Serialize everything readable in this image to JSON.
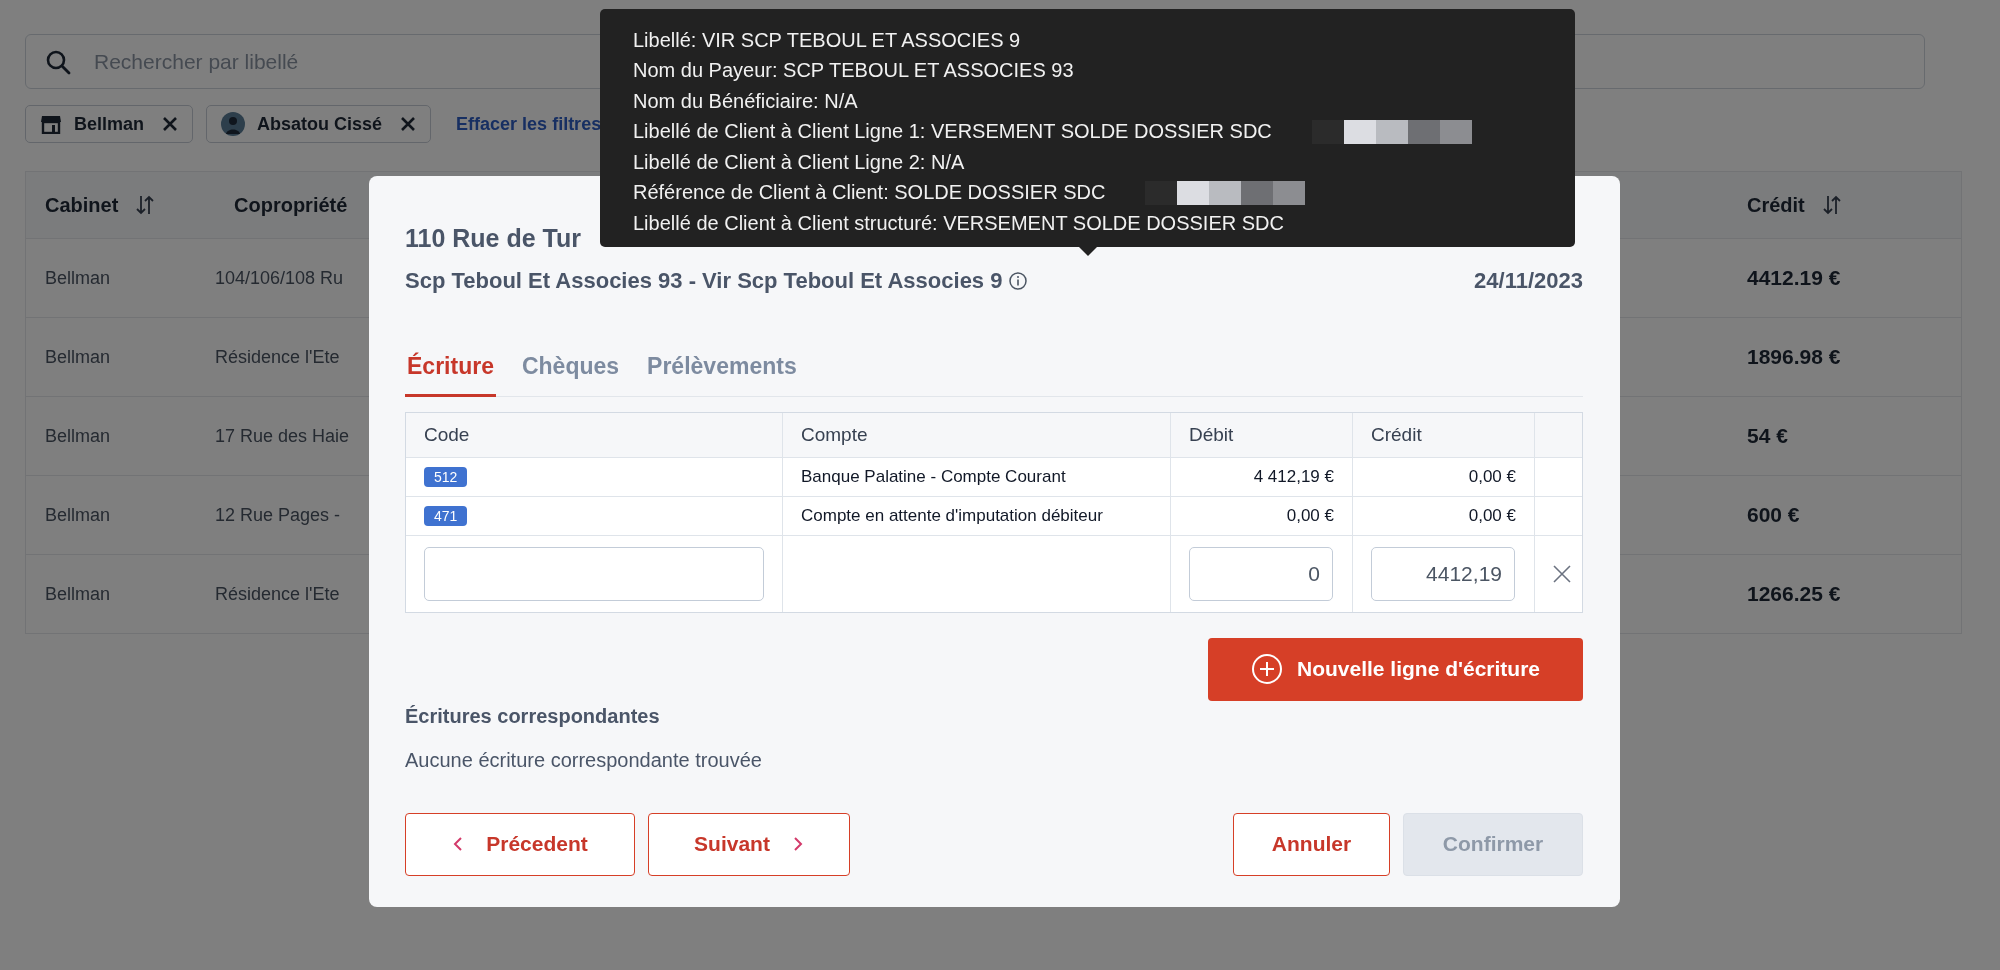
{
  "search": {
    "placeholder": "Rechercher par libellé"
  },
  "filters": [
    {
      "label": "Bellman",
      "kind": "cabinet"
    },
    {
      "label": "Absatou Cissé",
      "kind": "person"
    }
  ],
  "clear_filters": "Effacer les filtres",
  "table": {
    "columns": [
      {
        "label": "Cabinet",
        "sortable": true
      },
      {
        "label": "Copropriété",
        "sortable": false
      },
      {
        "label": "Crédit",
        "sortable": true
      }
    ],
    "rows": [
      {
        "cabinet": "Bellman",
        "copropriete": "104/106/108 Ru",
        "credit": "4412.19 €"
      },
      {
        "cabinet": "Bellman",
        "copropriete": "Résidence l'Ete",
        "credit": "1896.98 €"
      },
      {
        "cabinet": "Bellman",
        "copropriete": "17 Rue des Haie",
        "credit": "54 €"
      },
      {
        "cabinet": "Bellman",
        "copropriete": "12 Rue Pages -",
        "credit": "600 €"
      },
      {
        "cabinet": "Bellman",
        "copropriete": "Résidence l'Ete",
        "credit": "1266.25 €"
      }
    ]
  },
  "modal": {
    "title": "110 Rue de Tur",
    "subtitle": "Scp Teboul Et Associes 93 - Vir Scp Teboul Et Associes 9",
    "date": "24/11/2023",
    "tabs": [
      {
        "label": "Écriture",
        "selected": true
      },
      {
        "label": "Chèques",
        "selected": false
      },
      {
        "label": "Prélèvements",
        "selected": false
      }
    ],
    "entries": {
      "columns": [
        "Code",
        "Compte",
        "Débit",
        "Crédit"
      ],
      "rows": [
        {
          "code": "512",
          "account": "Banque Palatine - Compte Courant",
          "debit": "4 412,19 €",
          "credit": "0,00 €"
        },
        {
          "code": "471",
          "account": "Compte en attente d'imputation débiteur",
          "debit": "0,00 €",
          "credit": "0,00 €"
        }
      ],
      "new_row": {
        "debit": "0",
        "credit": "4412,19"
      }
    },
    "add_button": "Nouvelle ligne d'écriture",
    "matches": {
      "title": "Écritures correspondantes",
      "empty": "Aucune écriture correspondante trouvée"
    },
    "buttons": [
      {
        "label": "Précedent",
        "kind": "prev",
        "disabled": false
      },
      {
        "label": "Suivant",
        "kind": "next",
        "disabled": false
      },
      {
        "label": "Annuler",
        "kind": "cancel",
        "disabled": false
      },
      {
        "label": "Confirmer",
        "kind": "confirm",
        "disabled": true
      }
    ]
  },
  "tooltip": {
    "lines": [
      {
        "text": "Libellé: VIR SCP TEBOUL ET ASSOCIES 9",
        "redacted": false
      },
      {
        "text": "Nom du Payeur: SCP TEBOUL ET ASSOCIES 93",
        "redacted": false
      },
      {
        "text": "Nom du Bénéficiaire: N/A",
        "redacted": false
      },
      {
        "text": "Libellé de Client à Client Ligne 1: VERSEMENT SOLDE DOSSIER SDC",
        "redacted": true
      },
      {
        "text": "Libellé de Client à Client Ligne 2: N/A",
        "redacted": false
      },
      {
        "text": "Référence de Client à Client: SOLDE DOSSIER SDC",
        "redacted": true
      },
      {
        "text": "Libellé de Client à Client structuré: VERSEMENT SOLDE DOSSIER SDC",
        "redacted": false
      }
    ]
  }
}
